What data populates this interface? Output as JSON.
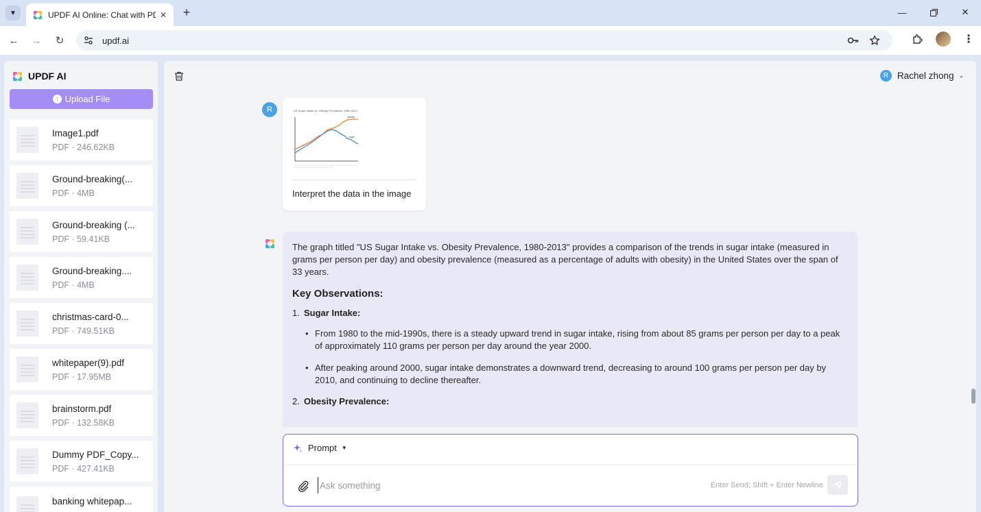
{
  "browser": {
    "tab_title": "UPDF AI Online: Chat with PDF",
    "url": "updf.ai"
  },
  "sidebar": {
    "brand": "UPDF AI",
    "upload_label": "Upload File",
    "files": [
      {
        "name": "Image1.pdf",
        "meta": "PDF · 246.62KB"
      },
      {
        "name": "Ground-breaking(...",
        "meta": "PDF · 4MB"
      },
      {
        "name": "Ground-breaking (...",
        "meta": "PDF · 59.41KB"
      },
      {
        "name": "Ground-breaking....",
        "meta": "PDF · 4MB"
      },
      {
        "name": "christmas-card-0...",
        "meta": "PDF · 749.51KB"
      },
      {
        "name": "whitepaper(9).pdf",
        "meta": "PDF · 17.95MB"
      },
      {
        "name": "brainstorm.pdf",
        "meta": "PDF · 132.58KB"
      },
      {
        "name": "Dummy PDF_Copy...",
        "meta": "PDF · 427.41KB"
      },
      {
        "name": "banking whitepap...",
        "meta": ""
      }
    ]
  },
  "header": {
    "user_initial": "R",
    "user_name": "Rachel zhong"
  },
  "chat": {
    "user_initial": "R",
    "user_message": "Interpret the data in the image",
    "thumbnail": {
      "title": "US Sugar Intake vs. Obesity Prevalence, 1980-2013",
      "labels": [
        "obesity",
        "sugar"
      ]
    },
    "ai": {
      "intro": "The graph titled \"US Sugar Intake vs. Obesity Prevalence, 1980-2013\" provides a comparison of the trends in sugar intake (measured in grams per person per day) and obesity prevalence (measured as a percentage of adults with obesity) in the United States over the span of 33 years.",
      "heading": "Key Observations:",
      "items": [
        {
          "num": "1.",
          "title": "Sugar Intake:",
          "bullets": [
            "From 1980 to the mid-1990s, there is a steady upward trend in sugar intake, rising from about 85 grams per person per day to a peak of approximately 110 grams per person per day around the year 2000.",
            "After peaking around 2000, sugar intake demonstrates a downward trend, decreasing to around 100 grams per person per day by 2010, and continuing to decline thereafter."
          ]
        },
        {
          "num": "2.",
          "title": "Obesity Prevalence:",
          "bullets": []
        }
      ]
    }
  },
  "composer": {
    "mode_label": "Prompt",
    "placeholder": "Ask something",
    "hint": "Enter Send; Shift + Enter Newline"
  },
  "colors": {
    "accent": "#7b6df0",
    "upload_button": "#a48ef6",
    "sugar_line": "#4a86c8",
    "obesity_line": "#e8822f"
  }
}
